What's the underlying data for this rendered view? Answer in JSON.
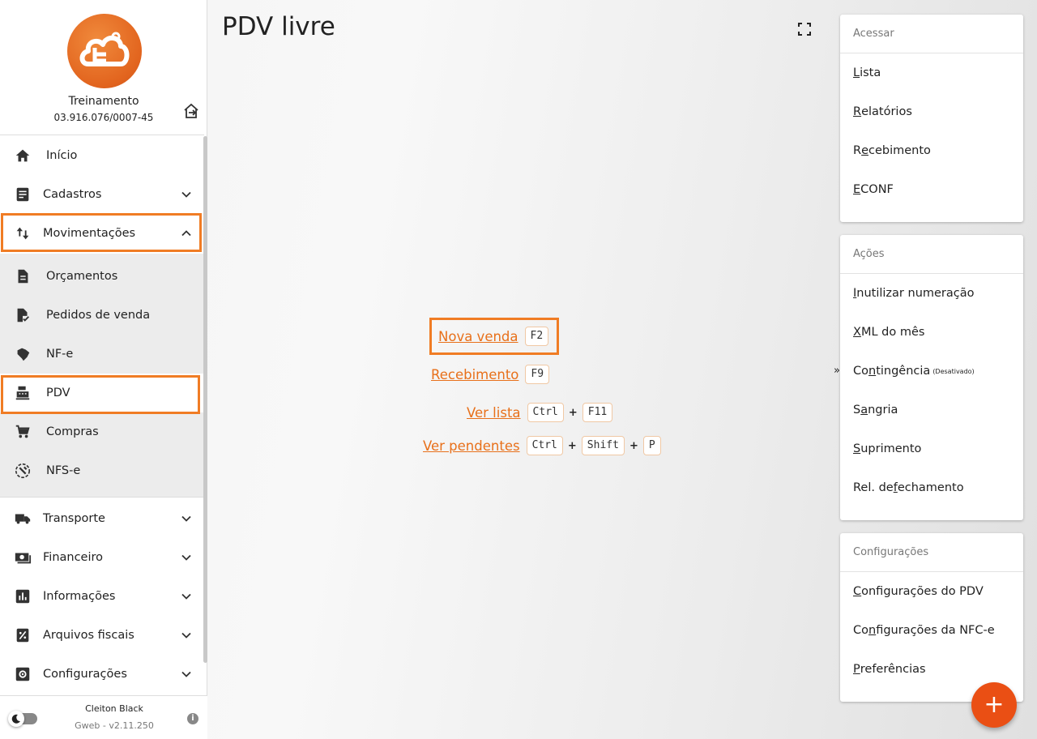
{
  "company": {
    "name": "Treinamento",
    "doc": "03.916.076/0007-45"
  },
  "nav": {
    "inicio": "Início",
    "cadastros": "Cadastros",
    "movimentacoes": "Movimentações",
    "orcamentos": "Orçamentos",
    "pedidos": "Pedidos de venda",
    "nfe": "NF-e",
    "pdv": "PDV",
    "compras": "Compras",
    "nfse": "NFS-e",
    "transporte": "Transporte",
    "financeiro": "Financeiro",
    "informacoes": "Informações",
    "arquivos": "Arquivos fiscais",
    "configuracoes": "Configurações"
  },
  "footer": {
    "user": "Cleiton Black",
    "version": "Gweb - v2.11.250"
  },
  "page": {
    "title": "PDV livre"
  },
  "shortcuts": {
    "nova_venda": {
      "label": "Nova venda",
      "key": "F2"
    },
    "recebimento": {
      "label": "Recebimento",
      "key": "F9"
    },
    "ver_lista": {
      "label": "Ver lista",
      "keys": [
        "Ctrl",
        "F11"
      ]
    },
    "ver_pendentes": {
      "label": "Ver pendentes",
      "keys": [
        "Ctrl",
        "Shift",
        "P"
      ]
    },
    "plus": "+"
  },
  "acessar": {
    "header": "Acessar",
    "items": [
      {
        "first": "L",
        "rest": "ista"
      },
      {
        "first": "R",
        "rest": "elatórios"
      },
      {
        "pre": "R",
        "u": "e",
        "rest": "cebimento"
      },
      {
        "first": "E",
        "rest": "CONF"
      }
    ]
  },
  "acoes": {
    "header": "Ações",
    "items": [
      {
        "pre": "",
        "u": "I",
        "rest": "nutilizar numeração"
      },
      {
        "pre": "",
        "u": "X",
        "rest": "ML do mês"
      },
      {
        "pre": "Co",
        "u": "n",
        "rest": "tingência",
        "note": "(Desativado)"
      },
      {
        "pre": "S",
        "u": "a",
        "rest": "ngria"
      },
      {
        "pre": "",
        "u": "S",
        "rest": "uprimento"
      },
      {
        "pre": "Rel. de ",
        "u": "f",
        "rest": "echamento"
      }
    ]
  },
  "configuracoes": {
    "header": "Configurações",
    "items": [
      {
        "pre": "",
        "u": "C",
        "rest": "onfigurações do PDV"
      },
      {
        "pre": "Co",
        "u": "n",
        "rest": "figurações da NFC-e"
      },
      {
        "pre": "",
        "u": "P",
        "rest": "referências"
      }
    ]
  },
  "collapse_mark": "»",
  "fab_label": "+",
  "colors": {
    "accent": "#f07c24",
    "fab": "#ea4f14"
  }
}
